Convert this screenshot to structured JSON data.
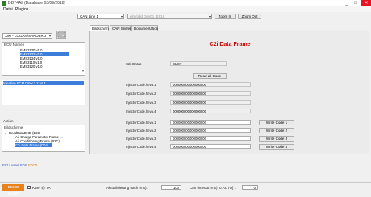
{
  "app": {
    "title": "DDT4All (Database 03/09/2018)",
    "window_controls": [
      "_",
      "□",
      "✕"
    ]
  },
  "menu": [
    "Datei",
    "Plugins"
  ],
  "toolbar": {
    "can_line": "CAN Line 1",
    "device_combo": "elm/obd Dev01_ECU",
    "zoom_in": "Zoom In",
    "zoom_out": "Zoom Out"
  },
  "left": {
    "vehicle": "X90 - LOGAN/SANDERO",
    "ecu_names_header": "ECU Namen",
    "ecus": [
      "EMS3130 v1.0",
      "EMS3132 v1.0",
      "EMS3134 v1.0",
      "EMS3110 v1.0",
      "EMS3120 v1.0"
    ],
    "selected_ecu_index": 1,
    "ecu_file": "Injection ECM D8W 1.2 v4.4",
    "action_label": "Aktion",
    "screens_header": "Bildschirme",
    "screens": [
      "ReadDataByID (B23)",
      "Air Charge Parameter Frame ...",
      "Air Conditioning Frame (B2C)",
      "C2i Data Frame (D04)"
    ],
    "selected_screen_index": 3
  },
  "tabs": {
    "items": [
      "Bildschirm",
      "CAN Sniffer",
      "Documentation"
    ],
    "active_index": 0
  },
  "screen": {
    "title": "C2i Data Frame",
    "status_label": "C2i Status",
    "status_value": "BUSY",
    "read_button": "Read all Code",
    "read_rows": [
      {
        "label": "InjectorCode.heva.1",
        "value": "000000000000000000"
      },
      {
        "label": "InjectorCode.heva.2",
        "value": "000000000000000000"
      },
      {
        "label": "InjectorCode.heva.3",
        "value": "000000000000000000"
      },
      {
        "label": "InjectorCode.heva.4",
        "value": "000000000000000000"
      }
    ],
    "write_rows": [
      {
        "label": "InjectorCode.heva.1",
        "value": "000000000000000000",
        "button": "Write Code 1"
      },
      {
        "label": "InjectorCode.heva.2",
        "value": "000000000000000000",
        "button": "Write Code 2"
      },
      {
        "label": "InjectorCode.heva.3",
        "value": "000000000000000000",
        "button": "Write Code 3"
      },
      {
        "label": "InjectorCode.heva.4",
        "value": "000000000000000000",
        "button": "Write Code 4"
      }
    ]
  },
  "log": {
    "line_prefix": "ECU uses SDS",
    "line_suffix": "E0C0"
  },
  "status": {
    "demo": "DEMO MODE",
    "kwp": "KWP @ TA",
    "refresh_label": "Aktualisierung nach (ms):",
    "refresh_value": "100",
    "can_timeout_label": "Can timeout (ms) [0:AUTO] :",
    "can_timeout_value": "0"
  },
  "colors": {
    "title_red": "#cc0000",
    "selection_blue": "#3b7dd8",
    "demo_orange": "#e8821d",
    "log_blue": "#2950c8"
  }
}
